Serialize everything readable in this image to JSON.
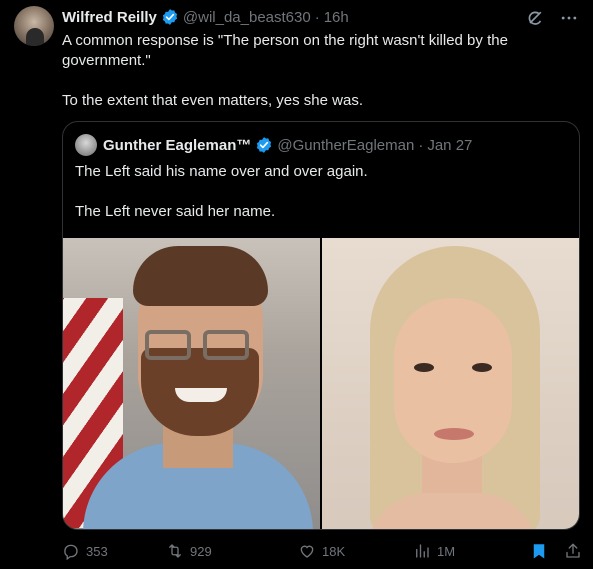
{
  "tweet": {
    "author_name": "Wilfred Reilly",
    "handle": "@wil_da_beast630",
    "separator": "·",
    "time": "16h",
    "text_lines": [
      "A common response is \"The person on the right wasn't killed by the",
      "government.\"",
      "To the extent that even matters, yes she was."
    ]
  },
  "quote": {
    "author_name": "Gunther Eagleman™",
    "handle": "@GuntherEagleman",
    "separator": "·",
    "date": "Jan 27",
    "text_lines": [
      "The Left said his name over and over again.",
      "The Left never said her name."
    ]
  },
  "actions": {
    "replies": "353",
    "retweets": "929",
    "likes": "18K",
    "views": "1M"
  },
  "icons": {
    "verified": "verified-badge-icon",
    "grok": "grok-icon",
    "more": "more-icon",
    "reply": "reply-icon",
    "retweet": "retweet-icon",
    "like": "heart-icon",
    "views": "views-icon",
    "bookmark": "bookmark-icon",
    "share": "share-icon"
  },
  "colors": {
    "background": "#000000",
    "text": "#e7e9ea",
    "muted": "#71767b",
    "verified": "#1d9bf0",
    "bookmark": "#1d9bf0",
    "border": "#2f3336"
  }
}
